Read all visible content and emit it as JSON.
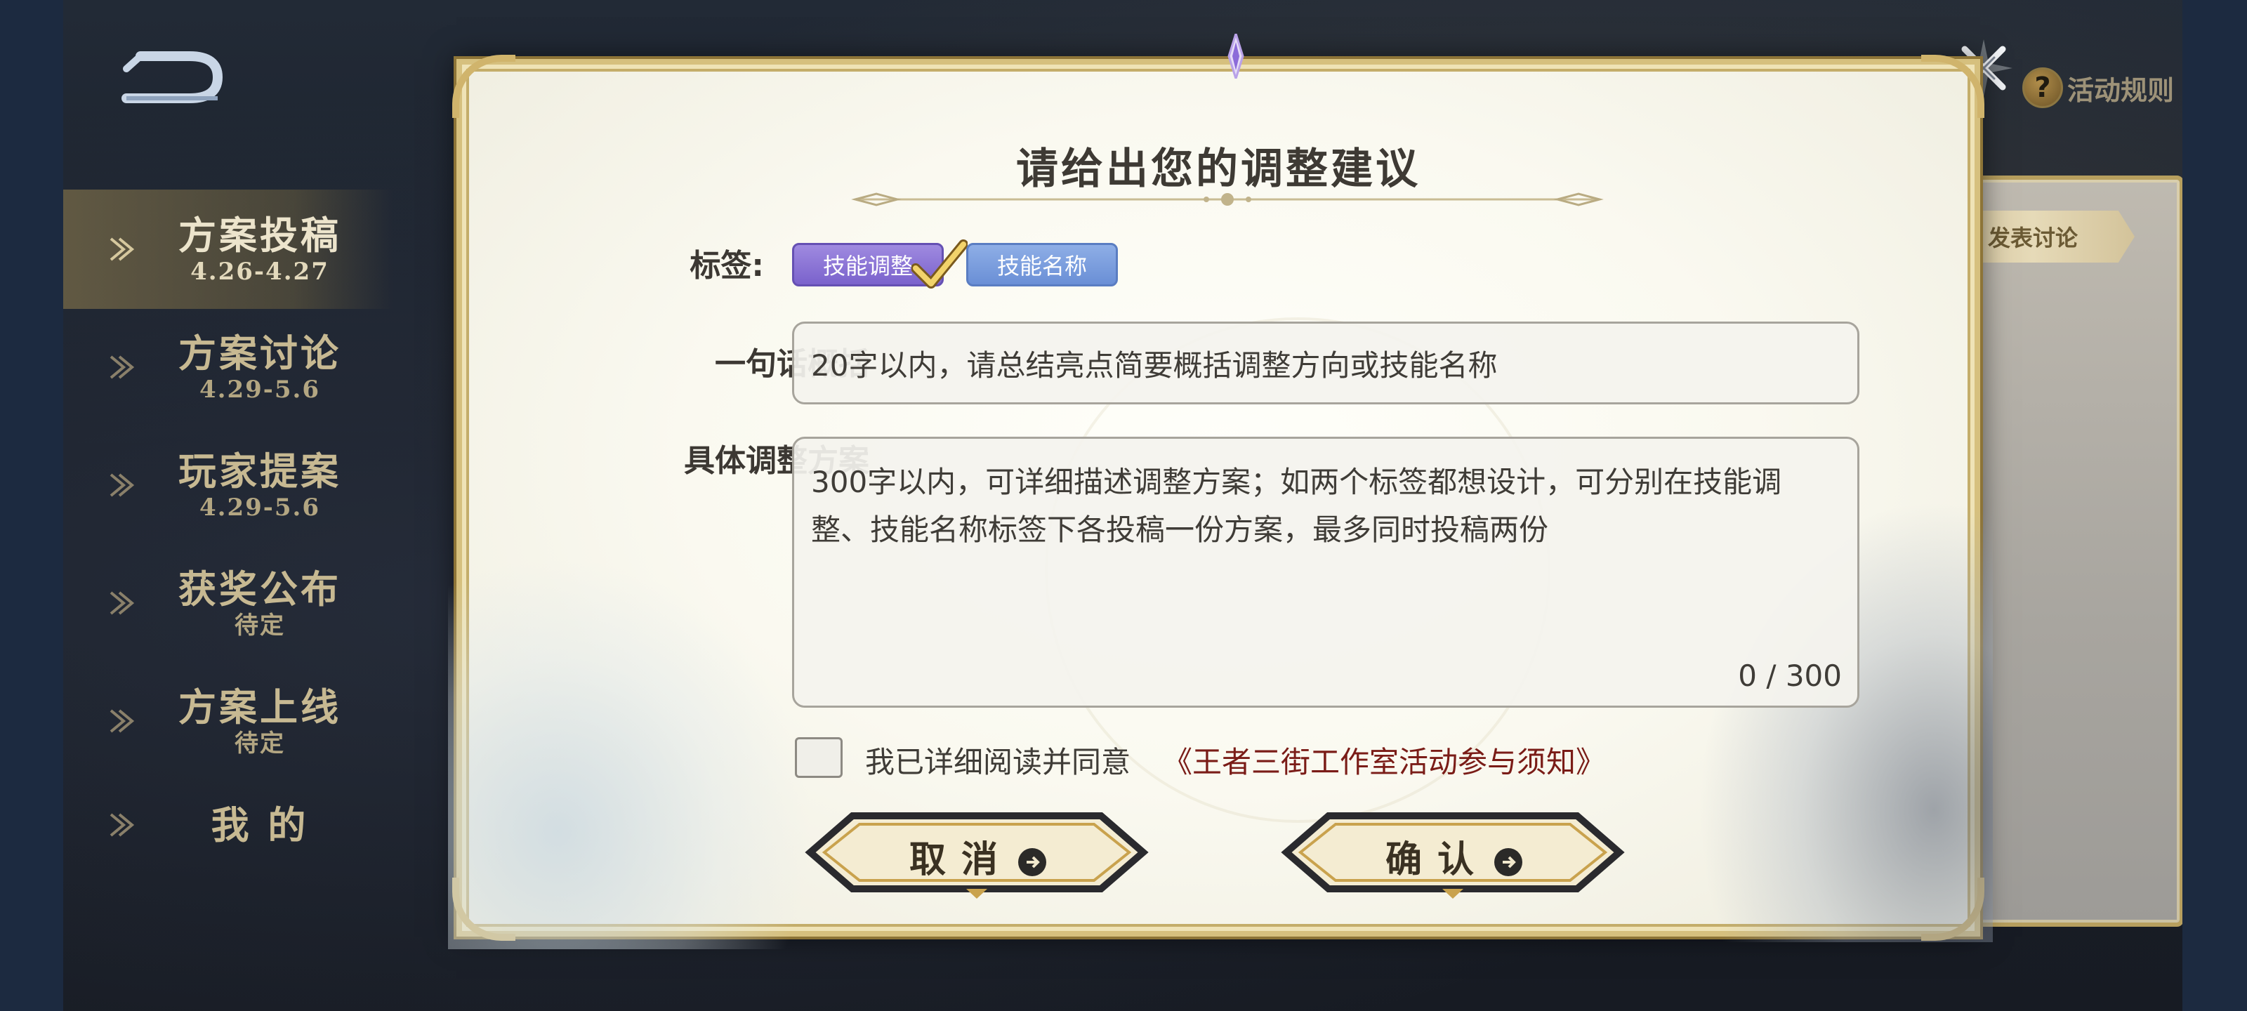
{
  "header": {
    "rules_label": "活动规则",
    "rules_icon": "?",
    "discussion_tab": "发表讨论"
  },
  "sidebar": {
    "items": [
      {
        "title": "方案投稿",
        "date": "4.26-4.27",
        "active": true
      },
      {
        "title": "方案讨论",
        "date": "4.29-5.6",
        "active": false
      },
      {
        "title": "玩家提案",
        "date": "4.29-5.6",
        "active": false
      },
      {
        "title": "获奖公布",
        "date": "待定",
        "active": false
      },
      {
        "title": "方案上线",
        "date": "待定",
        "active": false
      },
      {
        "title": "我 的",
        "date": "",
        "active": false
      }
    ]
  },
  "modal": {
    "title": "请给出您的调整建议",
    "tags_label": "标签:",
    "tags": [
      {
        "label": "技能调整",
        "selected": true,
        "color": "#7a62cc"
      },
      {
        "label": "技能名称",
        "selected": false,
        "color": "#6a8fd6"
      }
    ],
    "summary_label": "一句话概括",
    "summary_placeholder": "20字以内，请总结亮点简要概括调整方向或技能名称",
    "detail_label": "具体调整方案",
    "detail_placeholder": "300字以内，可详细描述调整方案；如两个标签都想设计，可分别在技能调整、技能名称标签下各投稿一份方案，最多同时投稿两份",
    "char_counter": "0 / 300",
    "agree_checked": false,
    "agree_text": "我已详细阅读并同意",
    "agree_link": "《王者三街工作室活动参与须知》",
    "cancel_label": "取消",
    "confirm_label": "确认"
  },
  "colors": {
    "background": "#1c2a40",
    "gold": "#d0b46c",
    "link_red": "#7a1c17",
    "tag_purple": "#7a62cc",
    "tag_blue": "#6a8fd6"
  },
  "icons": [
    "back-arrow-icon",
    "close-icon",
    "help-icon",
    "nav-arrow-icon",
    "checkmark-icon",
    "arrow-right-circle-icon",
    "gem-icon"
  ]
}
